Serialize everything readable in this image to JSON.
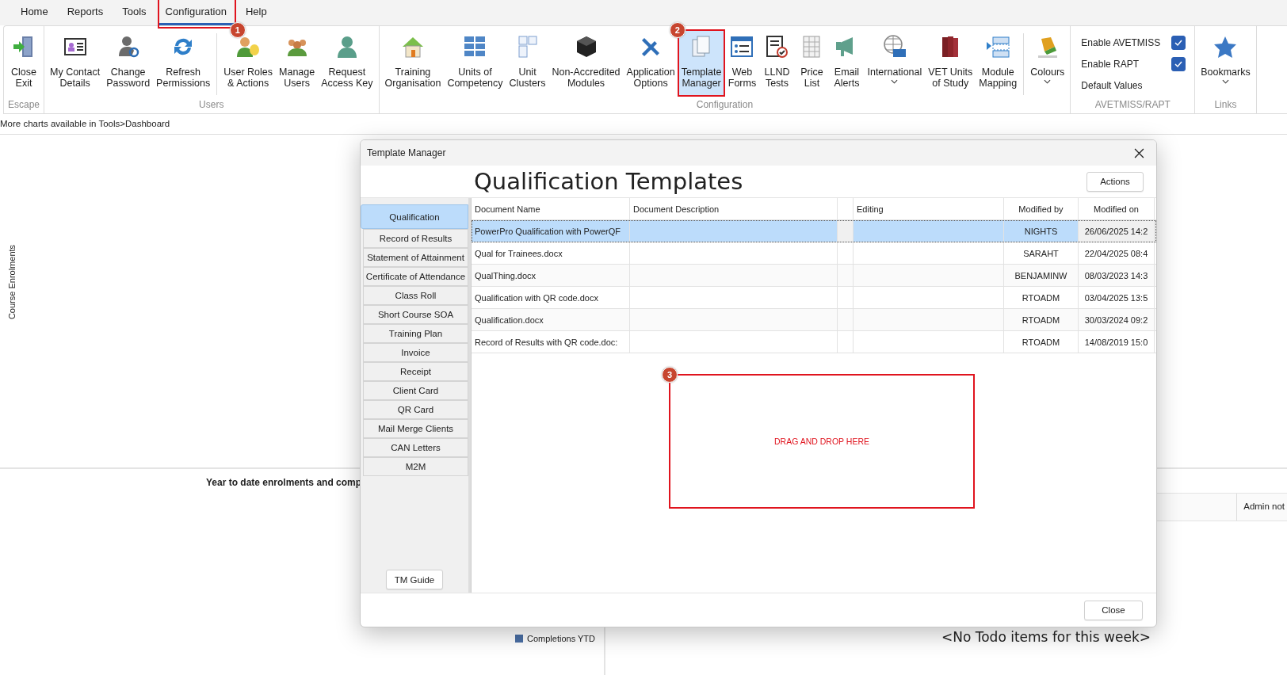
{
  "menu_tabs": [
    {
      "label": "Home",
      "selected": false
    },
    {
      "label": "Reports",
      "selected": false
    },
    {
      "label": "Tools",
      "selected": false
    },
    {
      "label": "Configuration",
      "selected": true,
      "annotation": "1"
    },
    {
      "label": "Help",
      "selected": false
    }
  ],
  "ribbon": {
    "groups": [
      {
        "label": "Escape",
        "sections": [
          [
            {
              "label": "Close\nExit"
            }
          ]
        ]
      },
      {
        "label": "Users",
        "sections": [
          [
            {
              "label": "My Contact\nDetails"
            },
            {
              "label": "Change\nPassword"
            },
            {
              "label": "Refresh\nPermissions"
            }
          ],
          [
            {
              "label": "User Roles\n& Actions"
            },
            {
              "label": "Manage\nUsers"
            },
            {
              "label": "Request\nAccess Key"
            }
          ]
        ]
      },
      {
        "label": "Configuration",
        "sections": [
          [
            {
              "label": "Training\nOrganisation"
            },
            {
              "label": "Units of\nCompetency"
            },
            {
              "label": "Unit\nClusters"
            },
            {
              "label": "Non-Accredited\nModules"
            },
            {
              "label": "Application\nOptions"
            },
            {
              "label": "Template\nManager",
              "selected": true,
              "annotation": "2"
            },
            {
              "label": "Web\nForms"
            },
            {
              "label": "LLND\nTests"
            },
            {
              "label": "Price\nList"
            },
            {
              "label": "Email\nAlerts"
            },
            {
              "label": "International",
              "dropdown": true
            },
            {
              "label": "VET Units\nof Study"
            },
            {
              "label": "Module\nMapping"
            }
          ],
          [
            {
              "label": "Colours",
              "dropdown": true
            }
          ]
        ]
      },
      {
        "label": "AVETMISS/RAPT",
        "options": [
          {
            "kind": "check",
            "label": "Enable AVETMISS",
            "checked": true
          },
          {
            "kind": "check",
            "label": "Enable RAPT",
            "checked": true
          },
          {
            "kind": "link",
            "label": "Default Values"
          }
        ]
      },
      {
        "label": "Links",
        "sections": [
          [
            {
              "label": "Bookmarks",
              "dropdown": true
            }
          ]
        ]
      }
    ]
  },
  "info_line": "More charts available in Tools>Dashboard",
  "dashboard": {
    "axis_label": "Course Enrolments",
    "ytd_title": "Year to date enrolments and comp",
    "legend": [
      {
        "label": "Completions YTD",
        "color": "#4a6fa5"
      }
    ],
    "notes_column": "Admin not",
    "todo_text": "<No Todo items for this week>"
  },
  "dialog": {
    "title": "Template Manager",
    "heading": "Qualification Templates",
    "actions_button": "Actions",
    "categories": [
      {
        "label": "Qualification",
        "selected": true
      },
      {
        "label": "Record of Results",
        "selected": false
      },
      {
        "label": "Statement of Attainment",
        "selected": false
      },
      {
        "label": "Certificate of Attendance",
        "selected": false
      },
      {
        "label": "Class Roll",
        "selected": false
      },
      {
        "label": "Short Course SOA",
        "selected": false
      },
      {
        "label": "Training Plan",
        "selected": false
      },
      {
        "label": "Invoice",
        "selected": false
      },
      {
        "label": "Receipt",
        "selected": false
      },
      {
        "label": "Client Card",
        "selected": false
      },
      {
        "label": "QR Card",
        "selected": false
      },
      {
        "label": "Mail Merge Clients",
        "selected": false
      },
      {
        "label": "CAN Letters",
        "selected": false
      },
      {
        "label": "M2M",
        "selected": false
      }
    ],
    "guide_button": "TM Guide",
    "table": {
      "columns": [
        "Document Name",
        "Document Description",
        null,
        "Editing",
        "Modified by",
        "Modified on"
      ],
      "rows": [
        {
          "document_name": "PowerPro Qualification with PowerQF",
          "modified_by": "NIGHTS",
          "modified_on": "26/06/2025 14:2",
          "selected": true
        },
        {
          "document_name": "Qual for Trainees.docx",
          "modified_by": "SARAHT",
          "modified_on": "22/04/2025 08:4",
          "selected": false
        },
        {
          "document_name": "QualThing.docx",
          "modified_by": "BENJAMINW",
          "modified_on": "08/03/2023 14:3",
          "selected": false
        },
        {
          "document_name": "Qualification with QR code.docx",
          "modified_by": "RTOADM",
          "modified_on": "03/04/2025 13:5",
          "selected": false
        },
        {
          "document_name": "Qualification.docx",
          "modified_by": "RTOADM",
          "modified_on": "30/03/2024 09:2",
          "selected": false
        },
        {
          "document_name": "Record of Results with QR code.doc:",
          "modified_by": "RTOADM",
          "modified_on": "14/08/2019 15:0",
          "selected": false
        }
      ]
    },
    "drop_zone": {
      "label": "DRAG AND DROP HERE",
      "annotation": "3"
    },
    "close_button": "Close"
  }
}
